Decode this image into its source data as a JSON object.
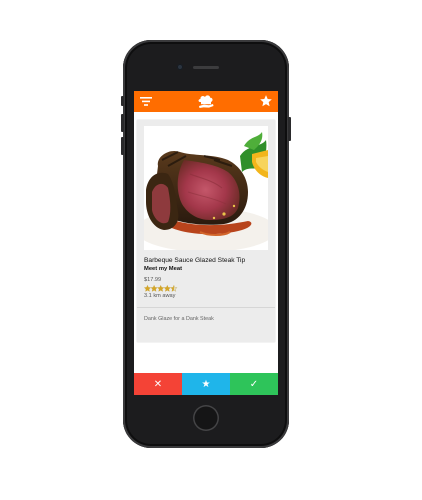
{
  "app": {
    "accent_color": "#ff6d00",
    "logo_icon": "chef-hat-hand-icon",
    "filter_icon": "filter-icon",
    "favorites_icon": "star-icon"
  },
  "item": {
    "title": "Barbeque Sauce Glazed Steak Tip",
    "restaurant": "Meet my Meat",
    "price": "$17.99",
    "rating": {
      "value": 4.5,
      "max": 5
    },
    "distance": "3.1 km away",
    "description": "Dank Glaze for a Dank Steak"
  },
  "actions": {
    "reject": {
      "glyph": "✕",
      "color": "#f44336"
    },
    "favorite": {
      "glyph": "★",
      "color": "#1fb5ea"
    },
    "accept": {
      "glyph": "✓",
      "color": "#2ec45a"
    }
  }
}
